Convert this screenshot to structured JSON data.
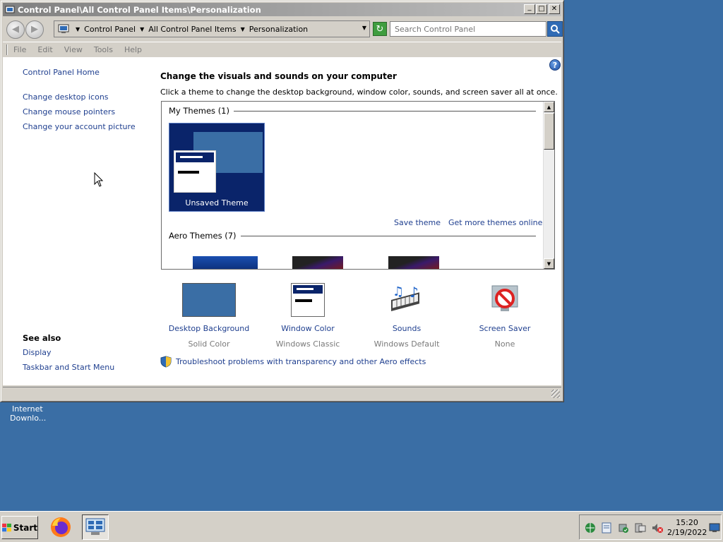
{
  "window": {
    "title": "Control Panel\\All Control Panel Items\\Personalization",
    "minimize": "_",
    "maximize": "□",
    "close": "✕"
  },
  "address": {
    "crumbs": [
      "Control Panel",
      "All Control Panel Items",
      "Personalization"
    ],
    "search_placeholder": "Search Control Panel"
  },
  "menu": [
    "File",
    "Edit",
    "View",
    "Tools",
    "Help"
  ],
  "left_nav": {
    "home": "Control Panel Home",
    "links": [
      "Change desktop icons",
      "Change mouse pointers",
      "Change your account picture"
    ],
    "see_also_title": "See also",
    "see_also": [
      "Display",
      "Taskbar and Start Menu"
    ]
  },
  "main": {
    "title": "Change the visuals and sounds on your computer",
    "description": "Click a theme to change the desktop background, window color, sounds, and screen saver all at once.",
    "my_themes_header": "My Themes (1)",
    "unsaved_theme": "Unsaved Theme",
    "save_theme": "Save theme",
    "get_more_themes": "Get more themes online",
    "aero_themes_header": "Aero Themes (7)",
    "help": "?"
  },
  "settings": [
    {
      "label": "Desktop Background",
      "value": "Solid Color",
      "icon": "desktop-background-icon"
    },
    {
      "label": "Window Color",
      "value": "Windows Classic",
      "icon": "window-color-icon"
    },
    {
      "label": "Sounds",
      "value": "Windows Default",
      "icon": "sounds-icon"
    },
    {
      "label": "Screen Saver",
      "value": "None",
      "icon": "screen-saver-icon"
    }
  ],
  "troubleshoot": "Troubleshoot problems with transparency and other Aero effects",
  "desktop_icon": {
    "line1": "Internet",
    "line2": "Downlo..."
  },
  "taskbar": {
    "start": "Start",
    "time": "15:20",
    "date": "2/19/2022"
  },
  "colors": {
    "desktop": "#3a6ea5",
    "classic_face": "#d4d0c8",
    "selection": "#0a246a",
    "link": "#1f3f8f"
  }
}
